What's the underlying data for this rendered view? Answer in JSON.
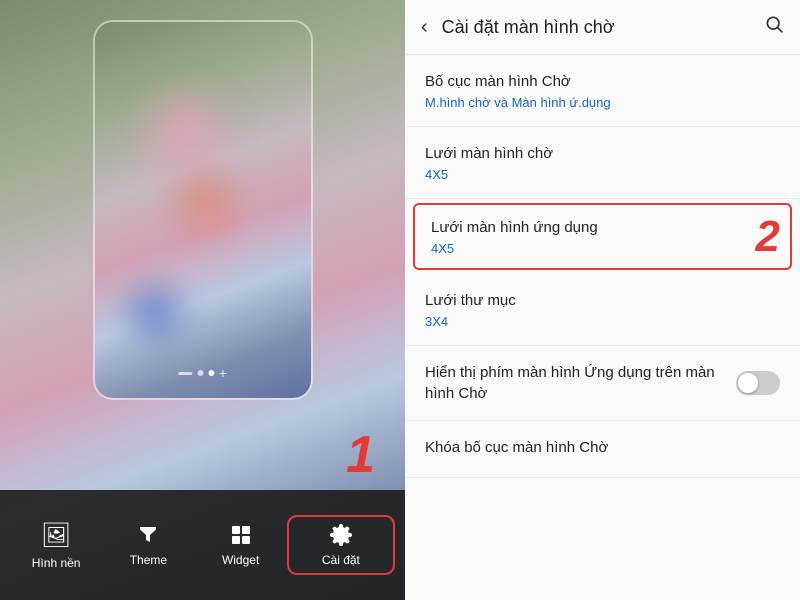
{
  "left_panel": {
    "bottom_bar": {
      "items": [
        {
          "id": "wallpaper",
          "label": "Hình nền",
          "icon": "🖼"
        },
        {
          "id": "theme",
          "label": "Theme",
          "icon": "🎨"
        },
        {
          "id": "widget",
          "label": "Widget",
          "icon": "⊞"
        },
        {
          "id": "settings",
          "label": "Cài đặt",
          "icon": "⚙",
          "highlighted": true
        }
      ]
    },
    "badge_1": "1"
  },
  "right_panel": {
    "header": {
      "title": "Cài đặt màn hình chờ",
      "back_icon": "‹",
      "search_icon": "🔍"
    },
    "settings": [
      {
        "id": "layout",
        "title": "Bố cục màn hình Chờ",
        "subtitle": "M.hình chờ và Màn hình ứ.dụng",
        "highlighted": false
      },
      {
        "id": "grid-home",
        "title": "Lưới màn hình chờ",
        "subtitle": "4X5",
        "highlighted": false
      },
      {
        "id": "grid-app",
        "title": "Lưới màn hình ứng dụng",
        "subtitle": "4X5",
        "highlighted": true,
        "badge": "2"
      },
      {
        "id": "grid-folder",
        "title": "Lưới thư mục",
        "subtitle": "3X4",
        "highlighted": false
      },
      {
        "id": "apps-button",
        "title": "Hiển thị phím màn hình Ứng dụng trên màn hình Chờ",
        "toggle": true,
        "toggle_on": false,
        "highlighted": false
      },
      {
        "id": "lock-layout",
        "title": "Khóa bố cục màn hình Chờ",
        "highlighted": false
      }
    ]
  }
}
